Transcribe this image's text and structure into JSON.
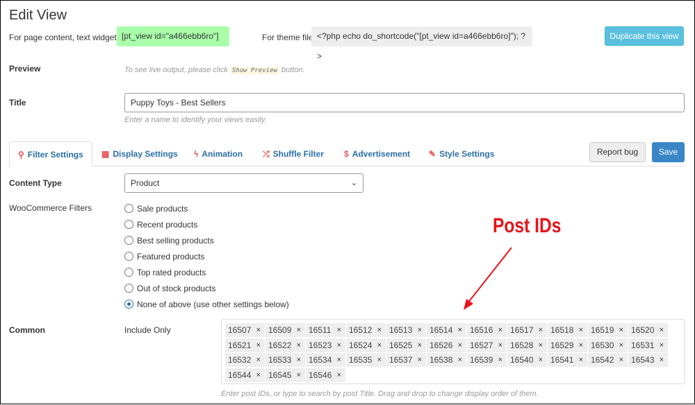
{
  "title": "Edit View",
  "shortcode": {
    "page_label": "For page content, text widget...",
    "page_code": "[pt_view id=\"a466ebb6ro\"]",
    "theme_label": "For theme file",
    "theme_code": "<?php echo do_shortcode(\"[pt_view id=a466ebb6ro]\"); ?>",
    "duplicate": "Duplicate this view"
  },
  "preview": {
    "label": "Preview",
    "hint_pre": "To see live output, please click",
    "hint_btn": "Show Preview",
    "hint_post": "button."
  },
  "title_field": {
    "label": "Title",
    "value": "Puppy Toys - Best Sellers",
    "hint": "Enter a name to identify your views easily."
  },
  "tabs": [
    {
      "label": "Filter Settings",
      "icon": "search-icon",
      "glyph": "⚲"
    },
    {
      "label": "Display Settings",
      "icon": "grid-icon",
      "glyph": "▦"
    },
    {
      "label": "Animation",
      "icon": "bolt-icon",
      "glyph": "ϟ"
    },
    {
      "label": "Shuffle Filter",
      "icon": "shuffle-icon",
      "glyph": "⤮"
    },
    {
      "label": "Advertisement",
      "icon": "dollar-icon",
      "glyph": "$"
    },
    {
      "label": "Style Settings",
      "icon": "pencil-icon",
      "glyph": "✎"
    }
  ],
  "report_bug": "Report bug",
  "save": "Save",
  "content_type": {
    "label": "Content Type",
    "value": "Product"
  },
  "woo": {
    "label": "WooCommerce Filters",
    "options": [
      "Sale products",
      "Recent products",
      "Best selling products",
      "Featured products",
      "Top rated products",
      "Out of stock products",
      "None of above (use other settings below)"
    ],
    "selected": 6
  },
  "common": {
    "label": "Common",
    "sub": "Include Only",
    "ids": [
      "16507",
      "16509",
      "16511",
      "16512",
      "16513",
      "16514",
      "16516",
      "16517",
      "16518",
      "16519",
      "16520",
      "16521",
      "16522",
      "16523",
      "16524",
      "16525",
      "16526",
      "16527",
      "16528",
      "16529",
      "16530",
      "16531",
      "16532",
      "16533",
      "16534",
      "16535",
      "16537",
      "16538",
      "16539",
      "16540",
      "16541",
      "16542",
      "16543",
      "16544",
      "16545",
      "16546"
    ],
    "remove": "×",
    "hint": "Enter post IDs, or type to search by post Title. Drag and drop to change display order of them."
  },
  "annotation": "Post IDs"
}
